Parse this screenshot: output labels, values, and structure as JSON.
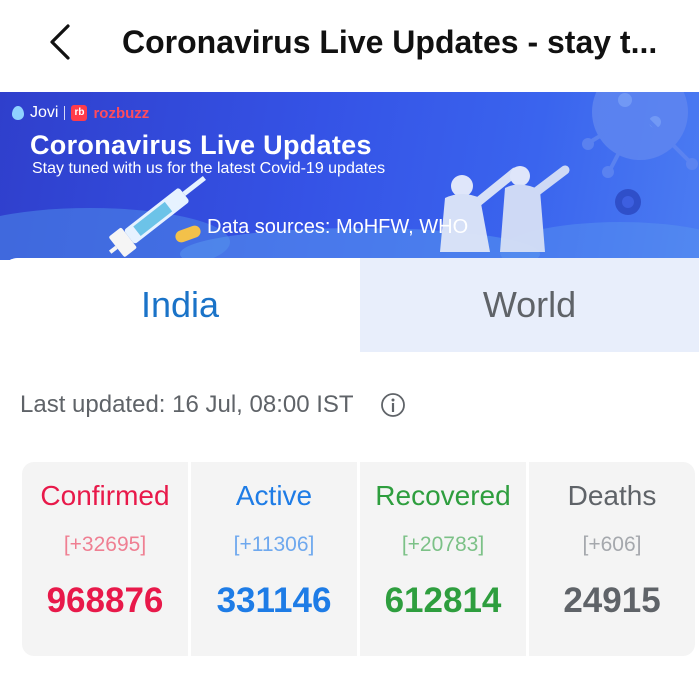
{
  "header": {
    "title": "Coronavirus Live Updates - stay t..."
  },
  "banner": {
    "brand_jovi": "Jovi",
    "brand_rozbuzz": "rozbuzz",
    "title": "Coronavirus Live Updates",
    "subtitle": "Stay tuned with us for the latest Covid-19 updates",
    "sources": "Data sources: MoHFW, WHO"
  },
  "tabs": [
    {
      "label": "India",
      "selected": true
    },
    {
      "label": "World",
      "selected": false
    }
  ],
  "last_updated": "Last updated: 16 Jul, 08:00 IST",
  "stats": [
    {
      "label": "Confirmed",
      "delta": "[+32695]",
      "total": "968876",
      "color": "#e8194a",
      "delta_color": "#ef7f92"
    },
    {
      "label": "Active",
      "delta": "[+11306]",
      "total": "331146",
      "color": "#1e7ce6",
      "delta_color": "#6ea8ee"
    },
    {
      "label": "Recovered",
      "delta": "[+20783]",
      "total": "612814",
      "color": "#2e9e3e",
      "delta_color": "#7cc187"
    },
    {
      "label": "Deaths",
      "delta": "[+606]",
      "total": "24915",
      "color": "#5f6368",
      "delta_color": "#a5a8ad"
    }
  ],
  "icons": {
    "back": "chevron-left-icon",
    "info": "info-circle-icon"
  }
}
